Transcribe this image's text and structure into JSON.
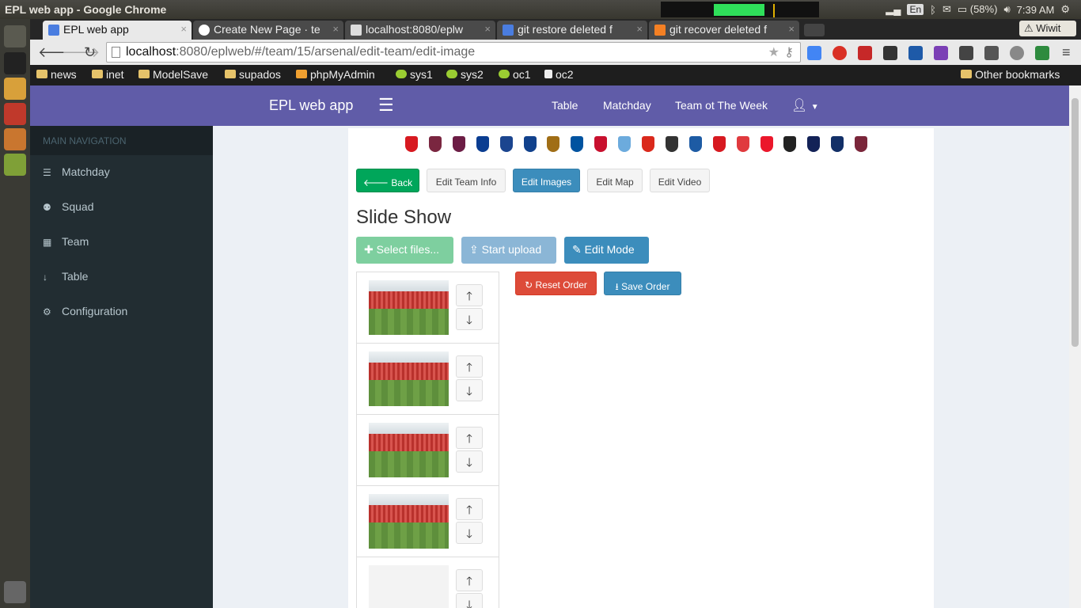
{
  "window": {
    "title": "EPL web app - Google Chrome"
  },
  "tray": {
    "battery": "(58%)",
    "time": "7:39 AM",
    "lang": "En"
  },
  "tabs": [
    {
      "label": "EPL web app",
      "active": true
    },
    {
      "label": "Create New Page · te",
      "active": false
    },
    {
      "label": "localhost:8080/eplw",
      "active": false
    },
    {
      "label": "git restore deleted f",
      "active": false
    },
    {
      "label": "git recover deleted f",
      "active": false
    }
  ],
  "profile": "Wiwit",
  "address": {
    "host": "localhost",
    "rest": ":8080/eplweb/#/team/15/arsenal/edit-team/edit-image"
  },
  "bookmarks": [
    {
      "label": "news",
      "icon": "folder-icon"
    },
    {
      "label": "inet",
      "icon": "folder-icon"
    },
    {
      "label": "ModelSave",
      "icon": "folder-icon"
    },
    {
      "label": "supados",
      "icon": "folder-icon"
    },
    {
      "label": "phpMyAdmin",
      "icon": "pma-icon"
    },
    {
      "label": "sys1",
      "icon": "leaf-icon"
    },
    {
      "label": "sys2",
      "icon": "leaf-icon"
    },
    {
      "label": "oc1",
      "icon": "leaf-icon"
    },
    {
      "label": "oc2",
      "icon": "page-icon"
    }
  ],
  "other_bookmarks": "Other bookmarks",
  "app": {
    "brand": "EPL web app",
    "top_links": [
      "Table",
      "Matchday",
      "Team ot The Week"
    ],
    "sidebar_header": "MAIN NAVIGATION",
    "sidebar_items": [
      {
        "label": "Matchday",
        "icon": "list-icon"
      },
      {
        "label": "Squad",
        "icon": "users-icon"
      },
      {
        "label": "Team",
        "icon": "table-icon"
      },
      {
        "label": "Table",
        "icon": "sort-icon"
      },
      {
        "label": "Configuration",
        "icon": "gear-icon"
      }
    ]
  },
  "crests": [
    "#d71920",
    "#7a2640",
    "#6c1d45",
    "#0a3d91",
    "#1b458f",
    "#11418c",
    "#a06e16",
    "#0053a0",
    "#c8102e",
    "#6cabdd",
    "#da291c",
    "#333333",
    "#1d5ba4",
    "#d71920",
    "#e03a3e",
    "#eb172b",
    "#222222",
    "#132257",
    "#122f67",
    "#7a263a"
  ],
  "edit_buttons": {
    "back": "Back",
    "info": "Edit Team Info",
    "images": "Edit Images",
    "map": "Edit Map",
    "video": "Edit Video"
  },
  "section_title": "Slide Show",
  "upload": {
    "select": "Select files...",
    "start": "Start upload",
    "edit_mode": "Edit Mode"
  },
  "order": {
    "reset": "Reset Order",
    "save": "Save Order"
  },
  "colors": {
    "header": "#605ca8",
    "sidebar": "#222d32",
    "success": "#00a65a",
    "primary": "#3c8dbc",
    "danger": "#dd4b39"
  }
}
